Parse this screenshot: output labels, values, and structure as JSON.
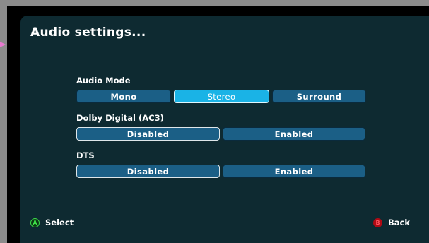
{
  "title": "Audio settings...",
  "colors": {
    "panel_background": "#0e2a31",
    "button_default": "#1b5f86",
    "button_highlighted": "#1ab3e6",
    "a_button": "#3ee04a",
    "b_button": "#b00a14"
  },
  "audio_mode": {
    "label": "Audio Mode",
    "options": [
      "Mono",
      "Stereo",
      "Surround"
    ],
    "selected": "Stereo"
  },
  "dolby": {
    "label": "Dolby Digital (AC3)",
    "options": [
      "Disabled",
      "Enabled"
    ],
    "selected": "Disabled"
  },
  "dts": {
    "label": "DTS",
    "options": [
      "Disabled",
      "Enabled"
    ],
    "selected": "Disabled"
  },
  "footer": {
    "a_glyph": "A",
    "select_label": "Select",
    "b_glyph": "B",
    "back_label": "Back"
  }
}
